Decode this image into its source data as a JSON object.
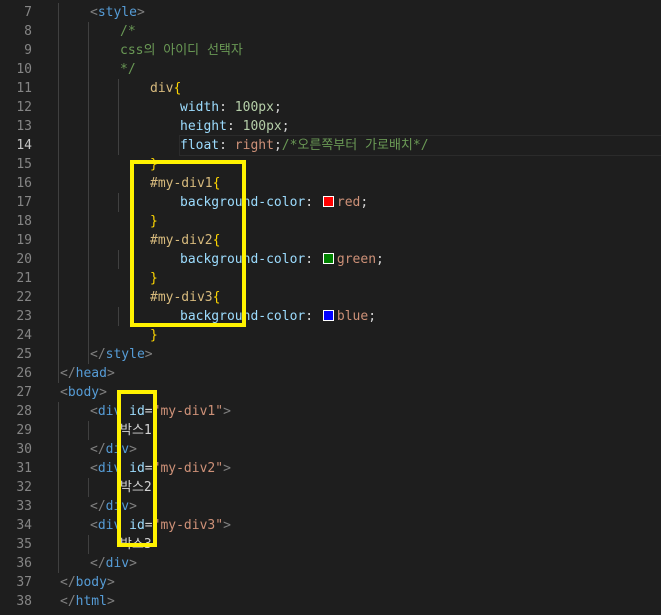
{
  "editor": {
    "active_line": 14,
    "lines": [
      {
        "n": "7",
        "tokens": [
          [
            "tag-bracket",
            "<"
          ],
          [
            "tag",
            "style"
          ],
          [
            "tag-bracket",
            ">"
          ]
        ]
      },
      {
        "n": "8",
        "tokens": [
          [
            "comment",
            "/*"
          ]
        ]
      },
      {
        "n": "9",
        "tokens": [
          [
            "comment",
            "css의 아이디 선택자"
          ]
        ]
      },
      {
        "n": "10",
        "tokens": [
          [
            "comment",
            "*/"
          ]
        ]
      },
      {
        "n": "11",
        "tokens": [
          [
            "selector",
            "div"
          ],
          [
            "brace",
            "{"
          ]
        ]
      },
      {
        "n": "12",
        "tokens": [
          [
            "prop",
            "width"
          ],
          [
            "punct",
            ": "
          ],
          [
            "num",
            "100px"
          ],
          [
            "punct",
            ";"
          ]
        ]
      },
      {
        "n": "13",
        "tokens": [
          [
            "prop",
            "height"
          ],
          [
            "punct",
            ": "
          ],
          [
            "num",
            "100px"
          ],
          [
            "punct",
            ";"
          ]
        ]
      },
      {
        "n": "14",
        "tokens": [
          [
            "prop",
            "float"
          ],
          [
            "punct",
            ": "
          ],
          [
            "value",
            "right"
          ],
          [
            "punct",
            ";"
          ],
          [
            "comment",
            "/*오른쪽부터 가로배치*/"
          ]
        ]
      },
      {
        "n": "15",
        "tokens": [
          [
            "brace",
            "}"
          ]
        ]
      },
      {
        "n": "16",
        "tokens": [
          [
            "selector",
            "#my-div1"
          ],
          [
            "brace",
            "{"
          ]
        ]
      },
      {
        "n": "17",
        "tokens": [
          [
            "prop",
            "background-color"
          ],
          [
            "punct",
            ": "
          ],
          [
            "swatch",
            "#ff0000"
          ],
          [
            "value",
            "red"
          ],
          [
            "punct",
            ";"
          ]
        ]
      },
      {
        "n": "18",
        "tokens": [
          [
            "brace",
            "}"
          ]
        ]
      },
      {
        "n": "19",
        "tokens": [
          [
            "selector",
            "#my-div2"
          ],
          [
            "brace",
            "{"
          ]
        ]
      },
      {
        "n": "20",
        "tokens": [
          [
            "prop",
            "background-color"
          ],
          [
            "punct",
            ": "
          ],
          [
            "swatch",
            "#008000"
          ],
          [
            "value",
            "green"
          ],
          [
            "punct",
            ";"
          ]
        ]
      },
      {
        "n": "21",
        "tokens": [
          [
            "brace",
            "}"
          ]
        ]
      },
      {
        "n": "22",
        "tokens": [
          [
            "selector",
            "#my-div3"
          ],
          [
            "brace",
            "{"
          ]
        ]
      },
      {
        "n": "23",
        "tokens": [
          [
            "prop",
            "background-color"
          ],
          [
            "punct",
            ": "
          ],
          [
            "swatch",
            "#0000ff"
          ],
          [
            "value",
            "blue"
          ],
          [
            "punct",
            ";"
          ]
        ]
      },
      {
        "n": "24",
        "tokens": [
          [
            "brace",
            "}"
          ]
        ]
      },
      {
        "n": "25",
        "tokens": [
          [
            "tag-bracket",
            "</"
          ],
          [
            "tag",
            "style"
          ],
          [
            "tag-bracket",
            ">"
          ]
        ]
      },
      {
        "n": "26",
        "tokens": [
          [
            "tag-bracket",
            "</"
          ],
          [
            "tag",
            "head"
          ],
          [
            "tag-bracket",
            ">"
          ]
        ]
      },
      {
        "n": "27",
        "tokens": [
          [
            "tag-bracket",
            "<"
          ],
          [
            "tag",
            "body"
          ],
          [
            "tag-bracket",
            ">"
          ]
        ]
      },
      {
        "n": "28",
        "tokens": [
          [
            "tag-bracket",
            "<"
          ],
          [
            "tag",
            "div"
          ],
          [
            "text",
            " "
          ],
          [
            "attr",
            "id"
          ],
          [
            "punct",
            "="
          ],
          [
            "str",
            "\"my-div1\""
          ],
          [
            "tag-bracket",
            ">"
          ]
        ]
      },
      {
        "n": "29",
        "tokens": [
          [
            "text",
            "박스1"
          ]
        ]
      },
      {
        "n": "30",
        "tokens": [
          [
            "tag-bracket",
            "</"
          ],
          [
            "tag",
            "div"
          ],
          [
            "tag-bracket",
            ">"
          ]
        ]
      },
      {
        "n": "31",
        "tokens": [
          [
            "tag-bracket",
            "<"
          ],
          [
            "tag",
            "div"
          ],
          [
            "text",
            " "
          ],
          [
            "attr",
            "id"
          ],
          [
            "punct",
            "="
          ],
          [
            "str",
            "\"my-div2\""
          ],
          [
            "tag-bracket",
            ">"
          ]
        ]
      },
      {
        "n": "32",
        "tokens": [
          [
            "text",
            "박스2"
          ]
        ]
      },
      {
        "n": "33",
        "tokens": [
          [
            "tag-bracket",
            "</"
          ],
          [
            "tag",
            "div"
          ],
          [
            "tag-bracket",
            ">"
          ]
        ]
      },
      {
        "n": "34",
        "tokens": [
          [
            "tag-bracket",
            "<"
          ],
          [
            "tag",
            "div"
          ],
          [
            "text",
            " "
          ],
          [
            "attr",
            "id"
          ],
          [
            "punct",
            "="
          ],
          [
            "str",
            "\"my-div3\""
          ],
          [
            "tag-bracket",
            ">"
          ]
        ]
      },
      {
        "n": "35",
        "tokens": [
          [
            "text",
            "박스3"
          ]
        ]
      },
      {
        "n": "36",
        "tokens": [
          [
            "tag-bracket",
            "</"
          ],
          [
            "tag",
            "div"
          ],
          [
            "tag-bracket",
            ">"
          ]
        ]
      },
      {
        "n": "37",
        "tokens": [
          [
            "tag-bracket",
            "</"
          ],
          [
            "tag",
            "body"
          ],
          [
            "tag-bracket",
            ">"
          ]
        ]
      },
      {
        "n": "38",
        "tokens": [
          [
            "tag-bracket",
            "</"
          ],
          [
            "tag",
            "html"
          ],
          [
            "tag-bracket",
            ">"
          ]
        ]
      }
    ]
  },
  "annotations": {
    "highlight_color": "#fff200"
  }
}
